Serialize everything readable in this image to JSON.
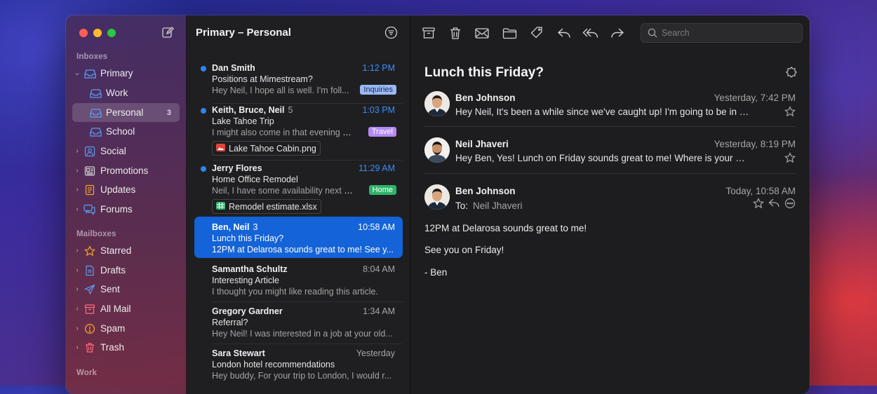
{
  "colors": {
    "accent": "#1463d8",
    "unread_dot": "#2f84f0",
    "tag_inquiries": "#9bb8f5",
    "tag_travel": "#b48af2",
    "tag_home": "#2fb36a"
  },
  "sidebar": {
    "sections": {
      "inboxes": "Inboxes",
      "mailboxes": "Mailboxes",
      "work": "Work"
    },
    "inboxes": [
      {
        "label": "Primary",
        "icon": "inbox-icon",
        "expanded": true,
        "badge": ""
      },
      {
        "label": "Work",
        "icon": "inbox-icon",
        "badge": ""
      },
      {
        "label": "Personal",
        "icon": "inbox-icon",
        "badge": "3",
        "selected": true
      },
      {
        "label": "School",
        "icon": "inbox-icon",
        "badge": ""
      },
      {
        "label": "Social",
        "icon": "people-icon",
        "badge": ""
      },
      {
        "label": "Promotions",
        "icon": "newspaper-icon",
        "badge": ""
      },
      {
        "label": "Updates",
        "icon": "document-icon",
        "badge": ""
      },
      {
        "label": "Forums",
        "icon": "chat-bubbles-icon",
        "badge": ""
      }
    ],
    "mailboxes": [
      {
        "label": "Starred",
        "icon": "star-icon"
      },
      {
        "label": "Drafts",
        "icon": "draft-icon"
      },
      {
        "label": "Sent",
        "icon": "paper-plane-icon"
      },
      {
        "label": "All Mail",
        "icon": "archive-box-icon"
      },
      {
        "label": "Spam",
        "icon": "warning-icon"
      },
      {
        "label": "Trash",
        "icon": "trash-icon"
      }
    ]
  },
  "list": {
    "title": "Primary – Personal",
    "messages": [
      {
        "from": "Dan Smith",
        "count": "",
        "time": "1:12 PM",
        "unread": true,
        "subject": "Positions at Mimestream?",
        "preview": "Hey Neil, I hope all is well. I'm foll...",
        "tag": "Inquiries",
        "attachment": ""
      },
      {
        "from": "Keith, Bruce, Neil",
        "count": "5",
        "time": "1:03 PM",
        "unread": true,
        "subject": "Lake Tahoe Trip",
        "preview": "I might also come in that evening an...",
        "tag": "Travel",
        "attachment": "Lake Tahoe Cabin.png"
      },
      {
        "from": "Jerry Flores",
        "count": "",
        "time": "11:29 AM",
        "unread": true,
        "subject": "Home Office Remodel",
        "preview": "Neil, I have some availability next we...",
        "tag": "Home",
        "attachment": "Remodel estimate.xlsx"
      },
      {
        "from": "Ben, Neil",
        "count": "3",
        "time": "10:58 AM",
        "unread": false,
        "selected": true,
        "subject": "Lunch this Friday?",
        "preview": "12PM at Delarosa sounds great to me! See y..."
      },
      {
        "from": "Samantha Schultz",
        "count": "",
        "time": "8:04 AM",
        "unread": false,
        "subject": "Interesting Article",
        "preview": "I thought you might like reading this article."
      },
      {
        "from": "Gregory Gardner",
        "count": "",
        "time": "1:34 AM",
        "unread": false,
        "subject": "Referral?",
        "preview": "Hey Neil! I was interested in a job at your old..."
      },
      {
        "from": "Sara Stewart",
        "count": "",
        "time": "Yesterday",
        "unread": false,
        "subject": "London hotel recommendations",
        "preview": "Hey buddy, For your trip to London, I would r..."
      }
    ]
  },
  "toolbar": {
    "search_placeholder": "Search"
  },
  "reader": {
    "subject": "Lunch this Friday?",
    "thread": [
      {
        "name": "Ben Johnson",
        "date": "Yesterday, 7:42 PM",
        "preview": "Hey Neil, It's been a while since we've caught up! I'm going to be in San..."
      },
      {
        "name": "Neil Jhaveri",
        "date": "Yesterday, 8:19 PM",
        "preview": "Hey Ben, Yes! Lunch on Friday sounds great to me! Where is your afternoo..."
      },
      {
        "name": "Ben Johnson",
        "date": "Today, 10:58 AM",
        "to_label": "To:",
        "to_name": "Neil Jhaveri"
      }
    ],
    "body": [
      "12PM at Delarosa sounds great to me!",
      "See you on Friday!",
      "- Ben"
    ]
  }
}
